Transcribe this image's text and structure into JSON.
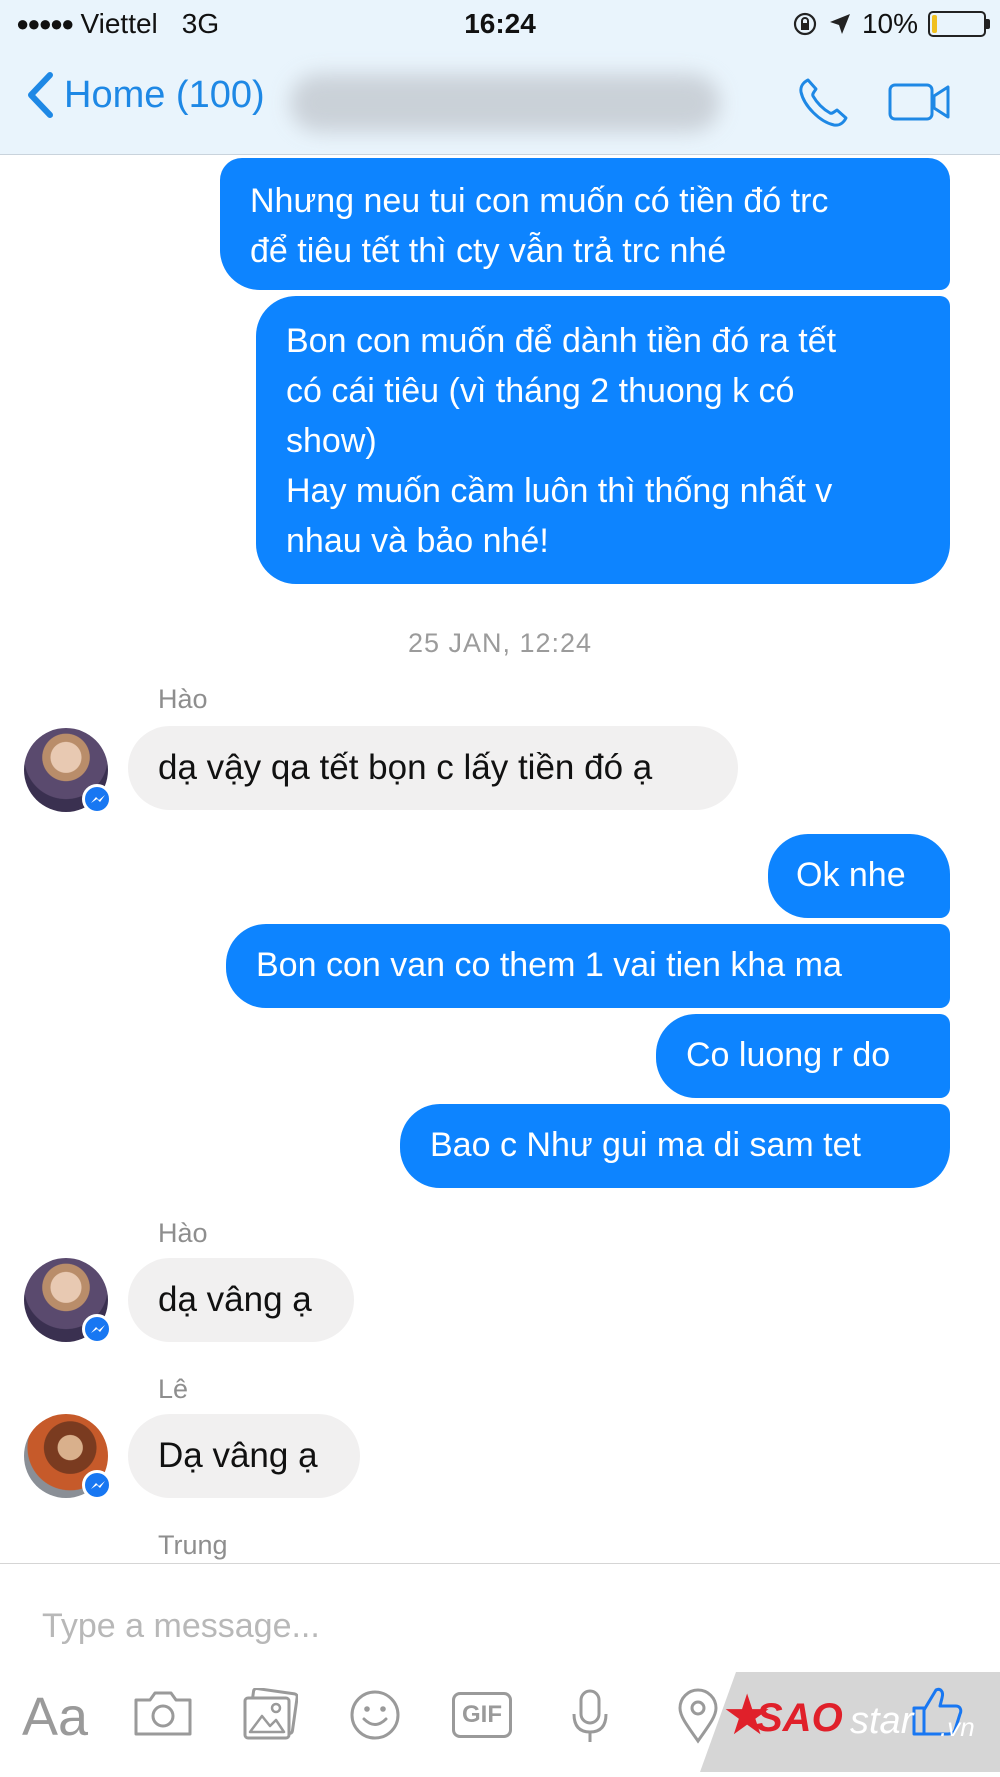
{
  "status_bar": {
    "signal": "●●●●●",
    "carrier": "Viettel",
    "network": "3G",
    "time": "16:24",
    "battery_percent": "10%",
    "battery_level": 0.1
  },
  "nav": {
    "back_label": "Home (100)"
  },
  "outgoing_top": [
    {
      "text": "Nhưng neu tui con muốn có tiền đó trc\nđể tiêu tết thì cty vẫn trả trc nhé"
    },
    {
      "text": "Bon con muốn để dành tiền đó ra tết\ncó cái tiêu (vì tháng 2 thuong k có\nshow)\nHay muốn cầm luôn thì thống nhất v\nnhau và bảo nhé!"
    }
  ],
  "timestamp": "25 JAN, 12:24",
  "incoming_1": {
    "sender": "Hào",
    "text": "dạ vậy qa tết bọn c lấy tiền đó ạ"
  },
  "outgoing_mid": [
    {
      "text": "Ok nhe"
    },
    {
      "text": "Bon con van co them 1 vai tien kha ma"
    },
    {
      "text": "Co luong r do"
    },
    {
      "text": "Bao c Như gui ma di sam tet"
    }
  ],
  "incoming_2": {
    "sender": "Hào",
    "text": "dạ vâng ạ"
  },
  "incoming_3": {
    "sender": "Lê",
    "text": "Dạ vâng ạ"
  },
  "incoming_4": {
    "sender": "Trung"
  },
  "composer": {
    "placeholder": "Type a message...",
    "aa_label": "Aa",
    "gif_label": "GIF"
  },
  "watermark": {
    "brand_sao": "SAO",
    "brand_star": "star",
    "brand_vn": ".vn"
  },
  "colors": {
    "accent": "#0d84ff",
    "incoming_bubble": "#f1f0f0",
    "nav_bg": "#e9f4fc"
  }
}
